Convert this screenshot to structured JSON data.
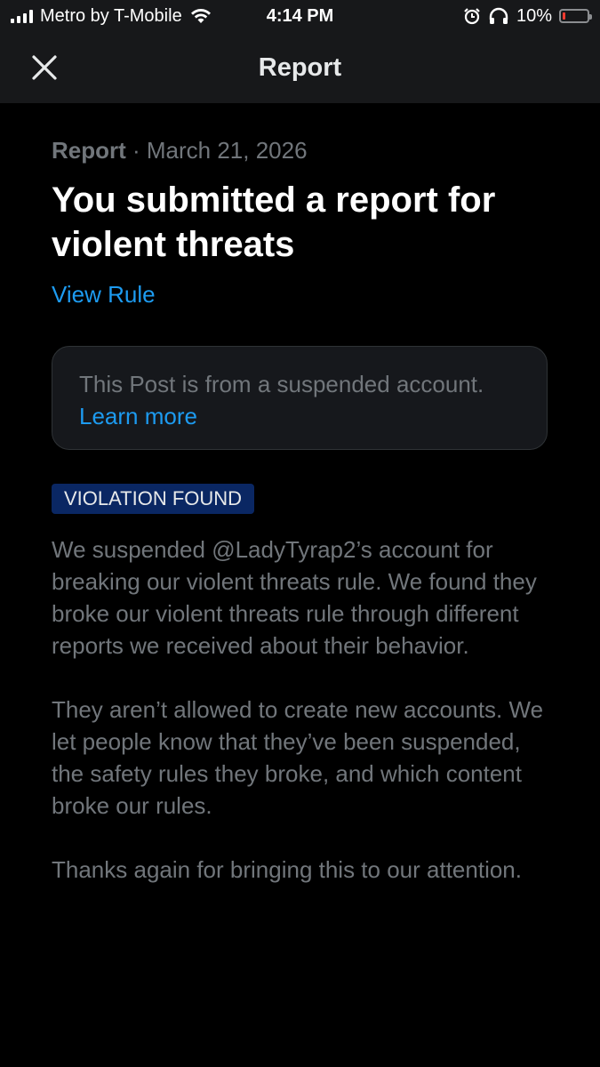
{
  "status_bar": {
    "carrier": "Metro by T-Mobile",
    "time": "4:14 PM",
    "battery": "10%",
    "battery_level": 0.1,
    "icons": [
      "signal-icon",
      "wifi-icon",
      "alarm-icon",
      "headphones-icon",
      "battery-icon"
    ]
  },
  "nav": {
    "title": "Report",
    "close_icon": "close-icon"
  },
  "report": {
    "meta_label": "Report",
    "meta_separator": " · ",
    "date": "March 21, 2026",
    "headline": "You submitted a report for violent threats",
    "view_rule": "View Rule"
  },
  "notice": {
    "text": "This Post is from a suspended account.",
    "link": "Learn more"
  },
  "badge": {
    "text": "VIOLATION FOUND",
    "color": "#0a2763"
  },
  "body": {
    "paragraphs": [
      "We suspended @LadyTyrap2’s account for breaking our violent threats rule. We found they broke our violent threats rule through different reports we received about their behavior.",
      "They aren’t allowed to create new accounts. We let people know that they’ve been suspended, the safety rules they broke, and which content broke our rules.",
      "Thanks again for bringing this to our attention."
    ]
  },
  "colors": {
    "background": "#000000",
    "header": "#17181a",
    "link": "#1d9bf0",
    "muted_text": "#71767b",
    "battery_low": "#ff3b30"
  }
}
